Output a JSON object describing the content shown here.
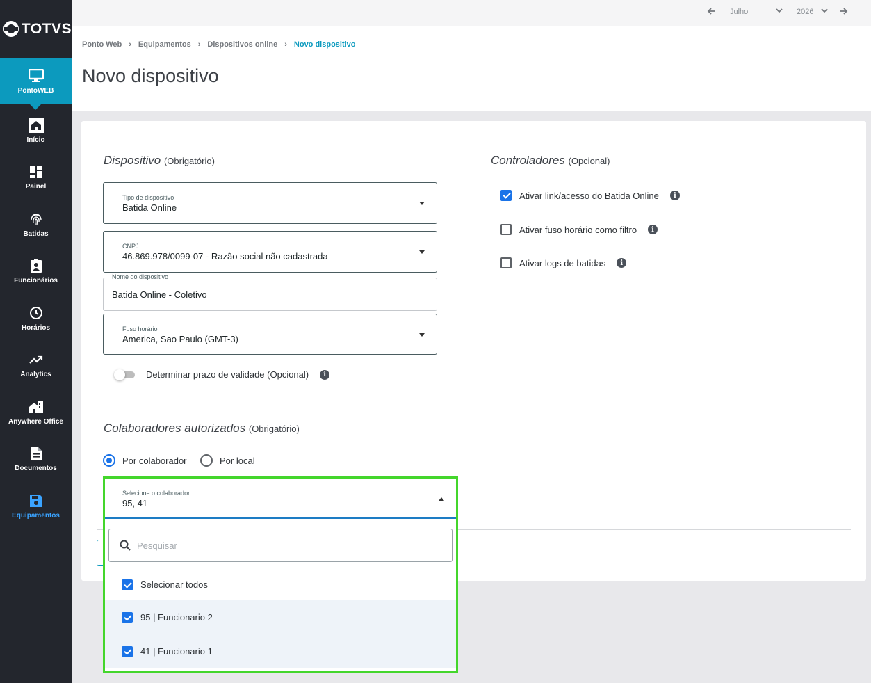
{
  "brand": {
    "logo_text": "TOTVS"
  },
  "sidebar": {
    "items": [
      {
        "label": "PontoWEB",
        "icon": "monitor-icon"
      },
      {
        "label": "Início",
        "icon": "home-icon"
      },
      {
        "label": "Painel",
        "icon": "dashboard-icon"
      },
      {
        "label": "Batidas",
        "icon": "fingerprint-icon"
      },
      {
        "label": "Funcionários",
        "icon": "badge-icon"
      },
      {
        "label": "Horários",
        "icon": "clock-icon"
      },
      {
        "label": "Analytics",
        "icon": "trend-icon"
      },
      {
        "label": "Anywhere Office",
        "icon": "building-icon"
      },
      {
        "label": "Documentos",
        "icon": "document-icon"
      },
      {
        "label": "Equipamentos",
        "icon": "device-icon"
      }
    ]
  },
  "topbar": {
    "month": "Julho",
    "year": "2026"
  },
  "breadcrumb": [
    "Ponto Web",
    "Equipamentos",
    "Dispositivos online",
    "Novo dispositivo"
  ],
  "page": {
    "title": "Novo dispositivo"
  },
  "device": {
    "section_title": "Dispositivo",
    "section_note": "(Obrigatório)",
    "type_label": "Tipo de dispositivo",
    "type_value": "Batida Online",
    "cnpj_label": "CNPJ",
    "cnpj_value": "46.869.978/0099-07 - Razão social não cadastrada",
    "name_label": "Nome do dispositivo",
    "name_value": "Batida Online - Coletivo",
    "tz_label": "Fuso horário",
    "tz_value": "America, Sao Paulo (GMT-3)",
    "validity_label": "Determinar prazo de validade (Opcional)",
    "validity_on": false
  },
  "controllers": {
    "section_title": "Controladores",
    "section_note": "(Opcional)",
    "options": [
      {
        "label": "Ativar link/acesso do Batida Online",
        "checked": true
      },
      {
        "label": "Ativar fuso horário como filtro",
        "checked": false
      },
      {
        "label": "Ativar logs de batidas",
        "checked": false
      }
    ]
  },
  "collaborators": {
    "section_title": "Colaboradores autorizados",
    "section_note": "(Obrigatório)",
    "radio_by_collaborator": "Por colaborador",
    "radio_by_location": "Por local",
    "selected_mode": "Por colaborador",
    "select_label": "Selecione o colaborador",
    "select_value": "95, 41",
    "search_placeholder": "Pesquisar",
    "select_all_label": "Selecionar todos",
    "select_all_checked": true,
    "items": [
      {
        "label": "95 | Funcionario 2",
        "checked": true
      },
      {
        "label": "41 | Funcionario 1",
        "checked": true
      }
    ]
  },
  "colors": {
    "primary": "#0c9abe",
    "checkbox": "#1a73e8",
    "highlight_border": "#44d62c",
    "sidebar_bg": "#23262d"
  }
}
